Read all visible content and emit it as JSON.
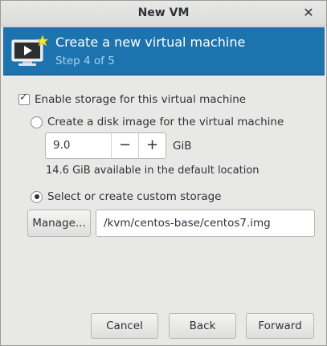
{
  "window": {
    "title": "New VM"
  },
  "header": {
    "title": "Create a new virtual machine",
    "step": "Step 4 of 5",
    "icon": "vm-monitor-icon"
  },
  "storage": {
    "enable_label": "Enable storage for this virtual machine",
    "enable_checked": true,
    "option_create_label": "Create a disk image for the virtual machine",
    "option_create_selected": false,
    "disk_size_value": "9.0",
    "disk_size_unit": "GiB",
    "decrement_label": "−",
    "increment_label": "+",
    "available_text": "14.6 GiB available in the default location",
    "option_custom_label": "Select or create custom storage",
    "option_custom_selected": true,
    "manage_label": "Manage...",
    "custom_path": "/kvm/centos-base/centos7.img"
  },
  "footer": {
    "cancel_label": "Cancel",
    "back_label": "Back",
    "forward_label": "Forward"
  },
  "colors": {
    "header_bg": "#1c73ae",
    "header_step": "#a6d4f5",
    "window_bg": "#e8e8e7"
  }
}
